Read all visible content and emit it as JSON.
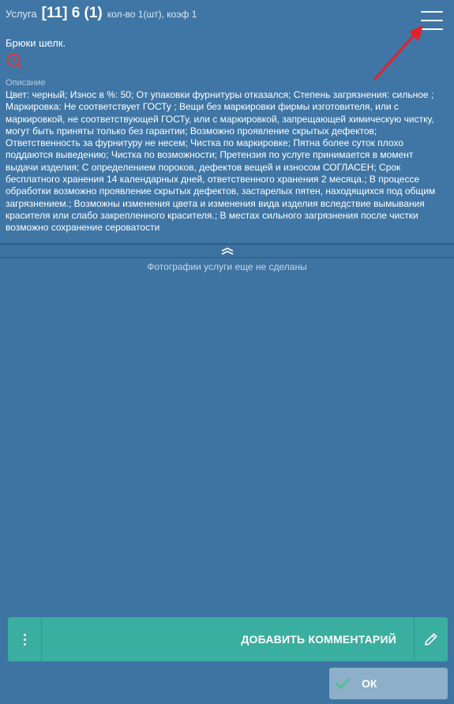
{
  "header": {
    "service_label": "Услуга",
    "code": "[11] 6 (1)",
    "quantity": "кол-во 1(шт), коэф 1"
  },
  "item": {
    "name": "Брюки шелк."
  },
  "description": {
    "label": "Описание",
    "text": "Цвет: черный; Износ в %: 50; От упаковки фурнитуры отказался; Степень загрязнения: сильное ; Маркировка: Не соответствует ГОСТу ; Вещи без маркировки фирмы изготовителя, или с маркировкой, не соответствующей ГОСТу, или с маркировкой, запрещающей химическую чистку, могут быть приняты только без гарантии; Возможно проявление скрытых дефектов; Ответственность за фурнитуру не несем; Чистка по маркировке; Пятна более суток плохо поддаются выведению; Чистка по возможности; Претензия по услуге принимается в момент выдачи изделия; С определением пороков, дефектов вещей и износом СОГЛАСЕН; Срок бесплатного хранения 14 календарных дней, ответственного хранения 2 месяца.;  В процессе обработки возможно проявление скрытых дефектов, застарелых пятен, находящихся под общим загрязнением.; Возможны изменения цвета и изменения вида изделия вследствие вымывания красителя или слабо закрепленного красителя.; В местах сильного загрязнения после чистки возможно сохранение сероватости"
  },
  "photos": {
    "empty_message": "Фотографии услуги еще не сделаны"
  },
  "actions": {
    "add_comment_label": "ДОБАВИТЬ КОММЕНТАРИЙ",
    "ok_label": "ОК"
  },
  "icons": {
    "menu": "hamburger-menu-icon",
    "history": "history-icon",
    "collapse": "chevron-double-up-icon",
    "more": "more-vertical-icon",
    "edit": "pencil-icon",
    "check": "check-icon",
    "annotation": "red-arrow"
  },
  "colors": {
    "background": "#3e74a2",
    "accent": "#3aaea0",
    "ok_button": "#8dafc9",
    "history_icon": "#d9383c",
    "annotation_arrow": "#e5202a"
  }
}
